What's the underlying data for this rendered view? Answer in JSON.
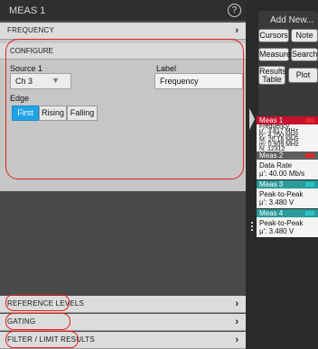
{
  "panel": {
    "title": "MEAS 1",
    "help_icon": "question-mark-circle-icon",
    "measurement_row": "FREQUENCY",
    "configure": {
      "header": "CONFIGURE",
      "source_label": "Source 1",
      "source_value": "Ch 3",
      "label_label": "Label",
      "label_value": "Frequency",
      "edge_label": "Edge",
      "edge_options": [
        "First",
        "Rising",
        "Falling"
      ],
      "edge_selected": "First"
    },
    "sections": [
      "REFERENCE LEVELS",
      "GATING",
      "FILTER / LIMIT RESULTS"
    ]
  },
  "side": {
    "add_new_title": "Add New...",
    "buttons": {
      "cursors": "Cursors",
      "note": "Note",
      "measure": "Measure",
      "search": "Search",
      "results_table": "Results Table",
      "plot": "Plot"
    },
    "meas1": {
      "title": "Meas 1",
      "lines": [
        "Frequency",
        "μ': 3.817 MHz",
        "σ': 4.250 MHz",
        "M: 20.18 MHz",
        "m: 0.909 MHz",
        "N: 12312"
      ]
    },
    "meas2": {
      "title": "Meas 2",
      "lines": [
        "Data Rate",
        "μ': 40.00 Mb/s"
      ]
    },
    "meas3": {
      "title": "Meas 3",
      "lines": [
        "Peak-to-Peak",
        "μ': 3.480 V"
      ]
    },
    "meas4": {
      "title": "Meas 4",
      "lines": [
        "Peak-to-Peak",
        "μ': 3.480 V"
      ]
    }
  },
  "colors": {
    "accent_blue": "#1fa3e6",
    "meas1_header": "#c8102e",
    "meas2_header": "#6a6a6a",
    "meas_cyan": "#2ac6c6",
    "meas_red_tag": "#e0282a",
    "highlight_outline": "#e32020"
  }
}
